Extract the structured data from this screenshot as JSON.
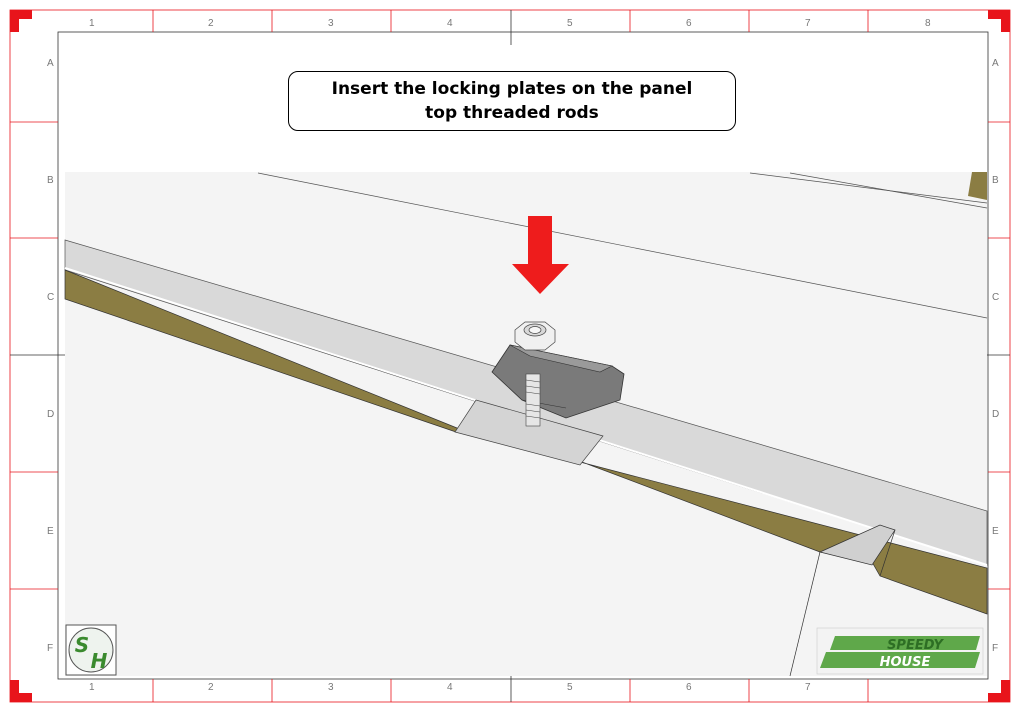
{
  "instruction": {
    "line1": "Insert the locking plates on the panel",
    "line2": "top threaded rods"
  },
  "grid": {
    "columns": [
      "1",
      "2",
      "3",
      "4",
      "5",
      "6",
      "7",
      "8"
    ],
    "rows": [
      "A",
      "B",
      "C",
      "D",
      "E",
      "F"
    ]
  },
  "logos": {
    "sh_left": "S",
    "sh_right": "H",
    "brand_line1": "SPEEDY",
    "brand_line2": "HOUSE"
  },
  "colors": {
    "frame_red": "#e8141b",
    "arrow_red": "#ee1c1c",
    "panel_gray": "#d9d9d9",
    "insulation_olive": "#8b7d43",
    "plate_gray": "#7a7a7a",
    "logo_green": "#3a8a2e"
  },
  "icons": [
    "down-arrow-icon",
    "sh-logo-icon",
    "speedy-house-logo-icon"
  ]
}
